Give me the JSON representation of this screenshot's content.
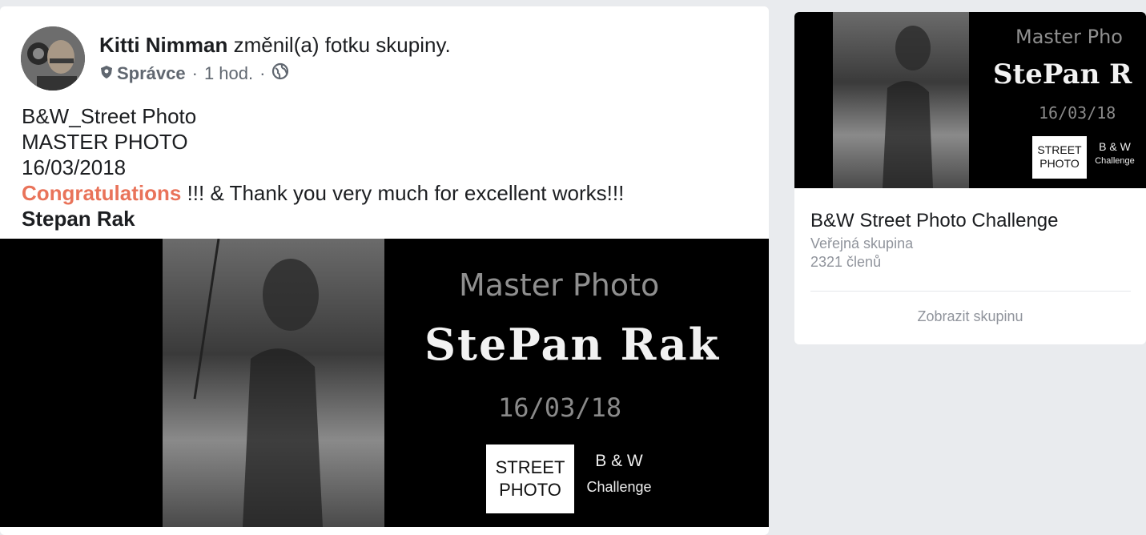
{
  "post": {
    "author": "Kitti Nimman",
    "action": "změnil(a) fotku skupiny.",
    "role": "Správce",
    "time": "1 hod.",
    "lines": [
      "B&W_Street Photo",
      "MASTER PHOTO",
      "16/03/2018"
    ],
    "congrats": "Congratulations",
    "thanks": " !!! & Thank you very much for excellent works!!!",
    "signature": "Stepan Rak"
  },
  "cover": {
    "title": "Master Photo",
    "name": "StePan Rak",
    "date": "16/03/18",
    "street_line1": "STREET",
    "street_line2": "PHOTO",
    "bw": "B & W",
    "challenge": "Challenge"
  },
  "card_cover": {
    "title": "Master Pho",
    "name": "StePan R"
  },
  "group_card": {
    "name": "B&W Street Photo Challenge",
    "type": "Veřejná skupina",
    "members": "2321 členů",
    "button": "Zobrazit skupinu"
  },
  "colors": {
    "accent": "#e9735a",
    "page_bg": "#e9ebee",
    "muted": "#90949c"
  },
  "icons": {
    "role": "shield-icon",
    "privacy": "globe-icon"
  }
}
